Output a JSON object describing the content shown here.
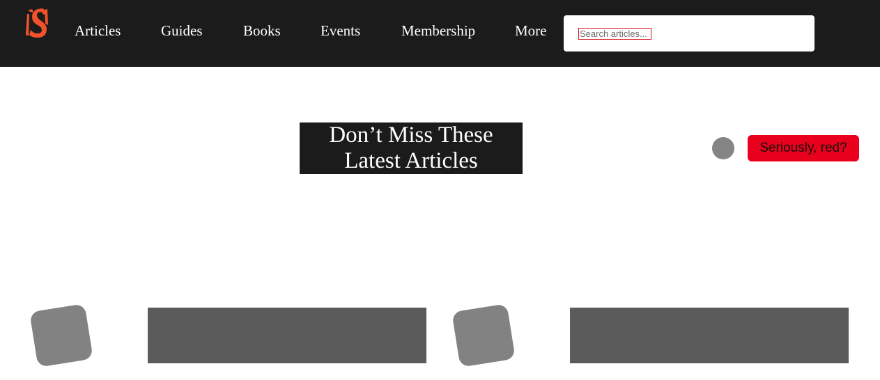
{
  "nav": {
    "items": [
      {
        "label": "Articles"
      },
      {
        "label": "Guides"
      },
      {
        "label": "Books"
      },
      {
        "label": "Events"
      },
      {
        "label": "Membership"
      },
      {
        "label": "More"
      }
    ]
  },
  "search": {
    "placeholder": "Search articles..."
  },
  "hero": {
    "title": "Don’t Miss These Latest Articles"
  },
  "promo": {
    "button_label": "Seriously, red?"
  },
  "colors": {
    "topbar": "#1b1b1b",
    "accent_red": "#e8001c",
    "logo_orange": "#f0522c"
  },
  "icons": {
    "logo": "smashing-s-logo-icon",
    "status": "circle-icon"
  }
}
